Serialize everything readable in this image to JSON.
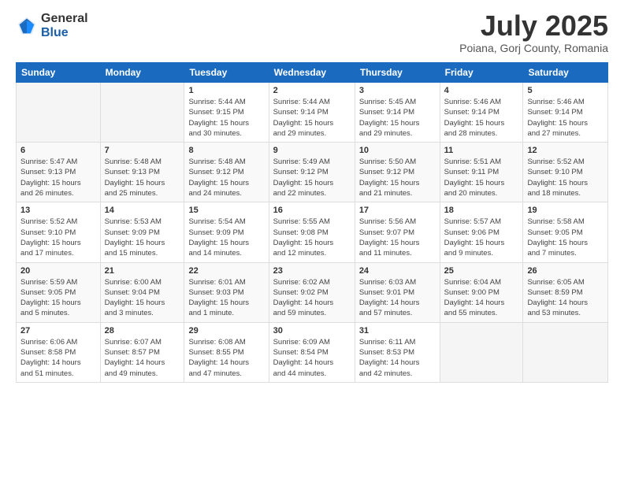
{
  "logo": {
    "general": "General",
    "blue": "Blue"
  },
  "title": {
    "month_year": "July 2025",
    "location": "Poiana, Gorj County, Romania"
  },
  "days_of_week": [
    "Sunday",
    "Monday",
    "Tuesday",
    "Wednesday",
    "Thursday",
    "Friday",
    "Saturday"
  ],
  "weeks": [
    [
      {
        "day": "",
        "info": ""
      },
      {
        "day": "",
        "info": ""
      },
      {
        "day": "1",
        "info": "Sunrise: 5:44 AM\nSunset: 9:15 PM\nDaylight: 15 hours\nand 30 minutes."
      },
      {
        "day": "2",
        "info": "Sunrise: 5:44 AM\nSunset: 9:14 PM\nDaylight: 15 hours\nand 29 minutes."
      },
      {
        "day": "3",
        "info": "Sunrise: 5:45 AM\nSunset: 9:14 PM\nDaylight: 15 hours\nand 29 minutes."
      },
      {
        "day": "4",
        "info": "Sunrise: 5:46 AM\nSunset: 9:14 PM\nDaylight: 15 hours\nand 28 minutes."
      },
      {
        "day": "5",
        "info": "Sunrise: 5:46 AM\nSunset: 9:14 PM\nDaylight: 15 hours\nand 27 minutes."
      }
    ],
    [
      {
        "day": "6",
        "info": "Sunrise: 5:47 AM\nSunset: 9:13 PM\nDaylight: 15 hours\nand 26 minutes."
      },
      {
        "day": "7",
        "info": "Sunrise: 5:48 AM\nSunset: 9:13 PM\nDaylight: 15 hours\nand 25 minutes."
      },
      {
        "day": "8",
        "info": "Sunrise: 5:48 AM\nSunset: 9:12 PM\nDaylight: 15 hours\nand 24 minutes."
      },
      {
        "day": "9",
        "info": "Sunrise: 5:49 AM\nSunset: 9:12 PM\nDaylight: 15 hours\nand 22 minutes."
      },
      {
        "day": "10",
        "info": "Sunrise: 5:50 AM\nSunset: 9:12 PM\nDaylight: 15 hours\nand 21 minutes."
      },
      {
        "day": "11",
        "info": "Sunrise: 5:51 AM\nSunset: 9:11 PM\nDaylight: 15 hours\nand 20 minutes."
      },
      {
        "day": "12",
        "info": "Sunrise: 5:52 AM\nSunset: 9:10 PM\nDaylight: 15 hours\nand 18 minutes."
      }
    ],
    [
      {
        "day": "13",
        "info": "Sunrise: 5:52 AM\nSunset: 9:10 PM\nDaylight: 15 hours\nand 17 minutes."
      },
      {
        "day": "14",
        "info": "Sunrise: 5:53 AM\nSunset: 9:09 PM\nDaylight: 15 hours\nand 15 minutes."
      },
      {
        "day": "15",
        "info": "Sunrise: 5:54 AM\nSunset: 9:09 PM\nDaylight: 15 hours\nand 14 minutes."
      },
      {
        "day": "16",
        "info": "Sunrise: 5:55 AM\nSunset: 9:08 PM\nDaylight: 15 hours\nand 12 minutes."
      },
      {
        "day": "17",
        "info": "Sunrise: 5:56 AM\nSunset: 9:07 PM\nDaylight: 15 hours\nand 11 minutes."
      },
      {
        "day": "18",
        "info": "Sunrise: 5:57 AM\nSunset: 9:06 PM\nDaylight: 15 hours\nand 9 minutes."
      },
      {
        "day": "19",
        "info": "Sunrise: 5:58 AM\nSunset: 9:05 PM\nDaylight: 15 hours\nand 7 minutes."
      }
    ],
    [
      {
        "day": "20",
        "info": "Sunrise: 5:59 AM\nSunset: 9:05 PM\nDaylight: 15 hours\nand 5 minutes."
      },
      {
        "day": "21",
        "info": "Sunrise: 6:00 AM\nSunset: 9:04 PM\nDaylight: 15 hours\nand 3 minutes."
      },
      {
        "day": "22",
        "info": "Sunrise: 6:01 AM\nSunset: 9:03 PM\nDaylight: 15 hours\nand 1 minute."
      },
      {
        "day": "23",
        "info": "Sunrise: 6:02 AM\nSunset: 9:02 PM\nDaylight: 14 hours\nand 59 minutes."
      },
      {
        "day": "24",
        "info": "Sunrise: 6:03 AM\nSunset: 9:01 PM\nDaylight: 14 hours\nand 57 minutes."
      },
      {
        "day": "25",
        "info": "Sunrise: 6:04 AM\nSunset: 9:00 PM\nDaylight: 14 hours\nand 55 minutes."
      },
      {
        "day": "26",
        "info": "Sunrise: 6:05 AM\nSunset: 8:59 PM\nDaylight: 14 hours\nand 53 minutes."
      }
    ],
    [
      {
        "day": "27",
        "info": "Sunrise: 6:06 AM\nSunset: 8:58 PM\nDaylight: 14 hours\nand 51 minutes."
      },
      {
        "day": "28",
        "info": "Sunrise: 6:07 AM\nSunset: 8:57 PM\nDaylight: 14 hours\nand 49 minutes."
      },
      {
        "day": "29",
        "info": "Sunrise: 6:08 AM\nSunset: 8:55 PM\nDaylight: 14 hours\nand 47 minutes."
      },
      {
        "day": "30",
        "info": "Sunrise: 6:09 AM\nSunset: 8:54 PM\nDaylight: 14 hours\nand 44 minutes."
      },
      {
        "day": "31",
        "info": "Sunrise: 6:11 AM\nSunset: 8:53 PM\nDaylight: 14 hours\nand 42 minutes."
      },
      {
        "day": "",
        "info": ""
      },
      {
        "day": "",
        "info": ""
      }
    ]
  ]
}
